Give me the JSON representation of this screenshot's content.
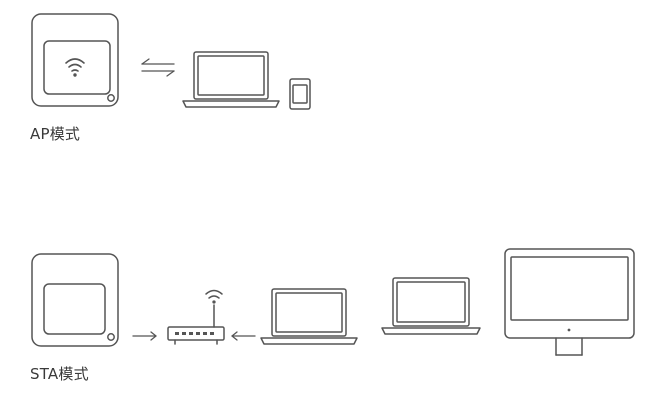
{
  "ap_section": {
    "label": "AP模式",
    "devices": [
      "device-with-wifi-icon",
      "bidirectional-arrows",
      "laptop",
      "phone"
    ]
  },
  "sta_section": {
    "label": "STA模式",
    "devices": [
      "device",
      "arrow-right",
      "wifi-router",
      "arrow-left",
      "laptop",
      "laptop",
      "desktop-monitor"
    ]
  },
  "colors": {
    "stroke": "#555555",
    "text": "#3a3a3a",
    "background": "#ffffff"
  }
}
